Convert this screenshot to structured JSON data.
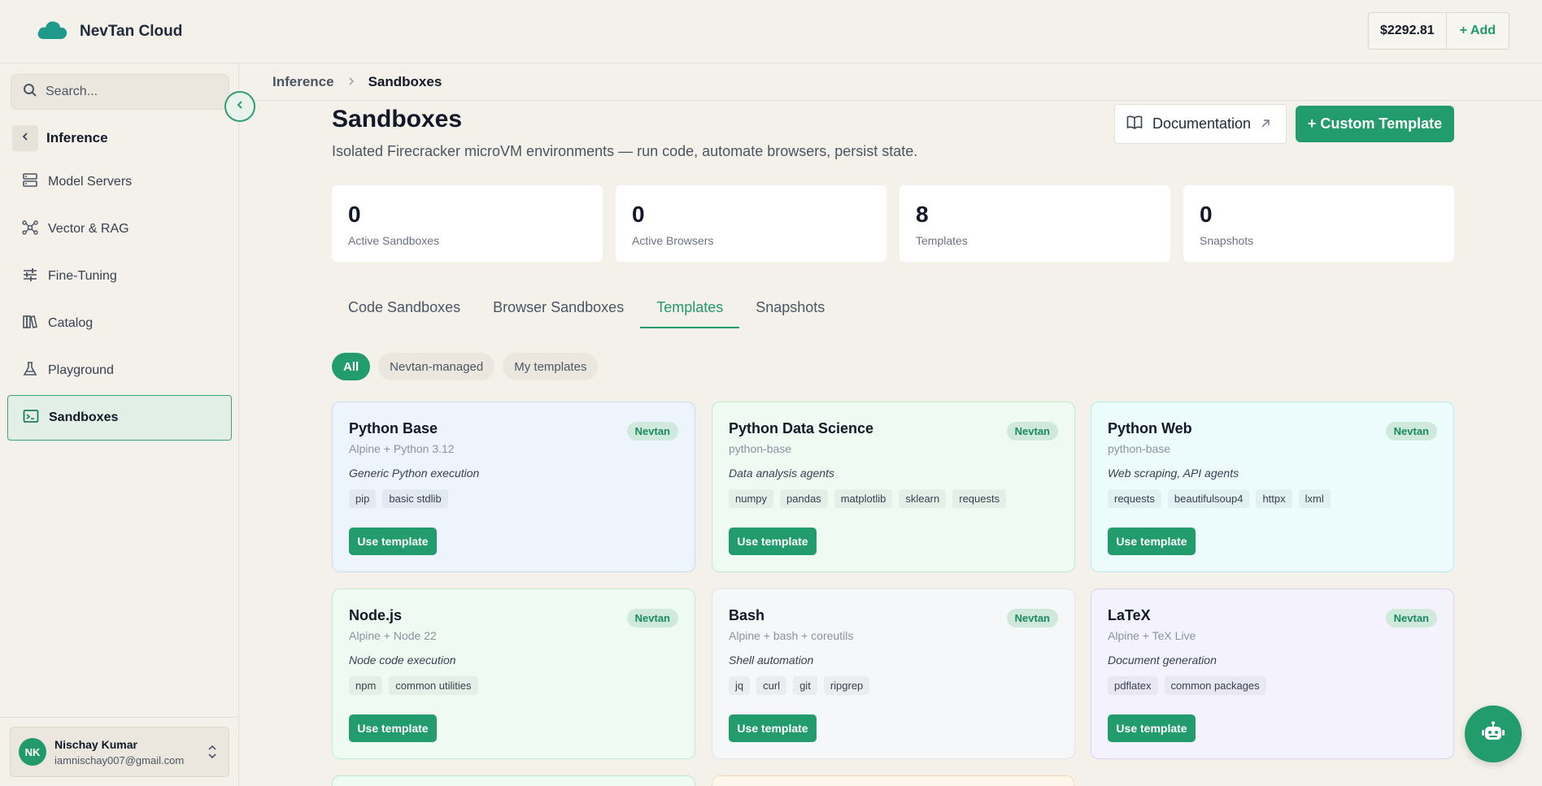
{
  "app": {
    "name": "NevTan Cloud"
  },
  "account": {
    "balance": "$2292.81",
    "add_label": "+ Add"
  },
  "sidebar": {
    "search_placeholder": "Search...",
    "section_title": "Inference",
    "items": [
      {
        "label": "Model Servers",
        "icon": "server-icon"
      },
      {
        "label": "Vector & RAG",
        "icon": "network-icon"
      },
      {
        "label": "Fine-Tuning",
        "icon": "sliders-icon"
      },
      {
        "label": "Catalog",
        "icon": "book-icon"
      },
      {
        "label": "Playground",
        "icon": "flask-icon"
      },
      {
        "label": "Sandboxes",
        "icon": "terminal-icon",
        "active": true
      }
    ],
    "user": {
      "initials": "NK",
      "name": "Nischay Kumar",
      "email": "iamnischay007@gmail.com"
    }
  },
  "breadcrumb": {
    "parent": "Inference",
    "current": "Sandboxes"
  },
  "page": {
    "title": "Sandboxes",
    "subtitle": "Isolated Firecracker microVM environments — run code, automate browsers, persist state.",
    "doc_button": "Documentation",
    "custom_button": "+ Custom Template"
  },
  "stats": [
    {
      "value": "0",
      "label": "Active Sandboxes"
    },
    {
      "value": "0",
      "label": "Active Browsers"
    },
    {
      "value": "8",
      "label": "Templates"
    },
    {
      "value": "0",
      "label": "Snapshots"
    }
  ],
  "tabs": [
    "Code Sandboxes",
    "Browser Sandboxes",
    "Templates",
    "Snapshots"
  ],
  "active_tab": "Templates",
  "filters": [
    "All",
    "Nevtan-managed",
    "My templates"
  ],
  "active_filter": "All",
  "use_label": "Use template",
  "templates": [
    {
      "title": "Python Base",
      "badge": "Nevtan",
      "base": "Alpine + Python 3.12",
      "desc": "Generic Python execution",
      "tags": [
        "pip",
        "basic stdlib"
      ],
      "bg": "#eef4fc",
      "border": "#c9dcf3"
    },
    {
      "title": "Python Data Science",
      "badge": "Nevtan",
      "base": "python-base",
      "desc": "Data analysis agents",
      "tags": [
        "numpy",
        "pandas",
        "matplotlib",
        "sklearn",
        "requests"
      ],
      "bg": "#eefaf2",
      "border": "#bfe8cf"
    },
    {
      "title": "Python Web",
      "badge": "Nevtan",
      "base": "python-base",
      "desc": "Web scraping, API agents",
      "tags": [
        "requests",
        "beautifulsoup4",
        "httpx",
        "lxml"
      ],
      "bg": "#ecfbfb",
      "border": "#b8ecec"
    },
    {
      "title": "Node.js",
      "badge": "Nevtan",
      "base": "Alpine + Node 22",
      "desc": "Node code execution",
      "tags": [
        "npm",
        "common utilities"
      ],
      "bg": "#effbf2",
      "border": "#c3ecd0"
    },
    {
      "title": "Bash",
      "badge": "Nevtan",
      "base": "Alpine + bash + coreutils",
      "desc": "Shell automation",
      "tags": [
        "jq",
        "curl",
        "git",
        "ripgrep"
      ],
      "bg": "#f6f7f9",
      "border": "#e1e4ea"
    },
    {
      "title": "LaTeX",
      "badge": "Nevtan",
      "base": "Alpine + TeX Live",
      "desc": "Document generation",
      "tags": [
        "pdflatex",
        "common packages"
      ],
      "bg": "#f4f2fd",
      "border": "#d9d3f3"
    }
  ]
}
